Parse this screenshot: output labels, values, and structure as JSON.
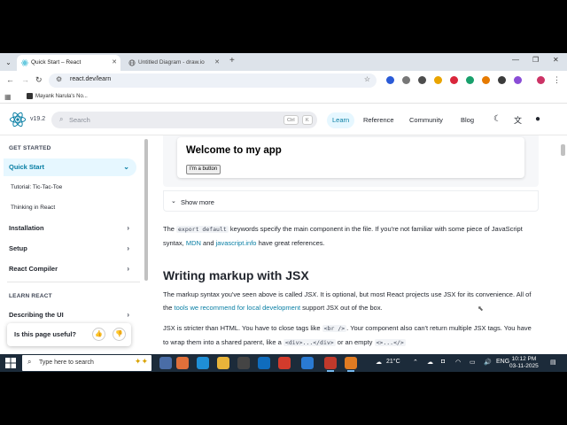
{
  "browser": {
    "tabs": [
      {
        "title": "Quick Start – React",
        "active": true
      },
      {
        "title": "Untitled Diagram - draw.io",
        "active": false
      }
    ],
    "address": "react.dev/learn",
    "bookmark": "Mayank Narula's No..."
  },
  "site": {
    "version": "v19.2",
    "search_placeholder": "Search",
    "search_kbd": [
      "Ctrl",
      "K"
    ],
    "nav": [
      "Learn",
      "Reference",
      "Community",
      "Blog"
    ],
    "accent": "#087ea4"
  },
  "sidebar": {
    "get_started": "GET STARTED",
    "quick_start": "Quick Start",
    "tutorial": "Tutorial: Tic-Tac-Toe",
    "thinking": "Thinking in React",
    "installation": "Installation",
    "setup": "Setup",
    "compiler": "React Compiler",
    "learn_react": "LEARN REACT",
    "describing": "Describing the UI",
    "feedback_question": "Is this page useful?"
  },
  "content": {
    "preview_heading": "Welcome to my app",
    "preview_button": "I'm a button",
    "show_more": "Show more",
    "p1_a": "The ",
    "p1_code": "export default",
    "p1_b": " keywords specify the main component in the file. If you're not familiar with some piece of JavaScript syntax, ",
    "p1_link1": "MDN",
    "p1_c": " and ",
    "p1_link2": "javascript.info",
    "p1_d": " have great references.",
    "h2": "Writing markup with JSX",
    "p2_a": "The markup syntax you've seen above is called ",
    "p2_em": "JSX",
    "p2_b": ". It is optional, but most React projects use JSX for its convenience. All of the ",
    "p2_link": "tools we recommend for local development",
    "p2_c": " support JSX out of the box.",
    "p3_a": "JSX is stricter than HTML. You have to close tags like ",
    "p3_code1": "<br />",
    "p3_b": ". Your component also can't return multiple JSX tags. You have to wrap them into a shared parent, like a ",
    "p3_code2": "<div>...</div>",
    "p3_c": " or an empty ",
    "p3_code3": "<>...</>"
  },
  "taskbar": {
    "search_placeholder": "Type here to search",
    "temperature": "21°C",
    "language": "ENG",
    "time": "10:12 PM",
    "date": "03-11-2025"
  }
}
